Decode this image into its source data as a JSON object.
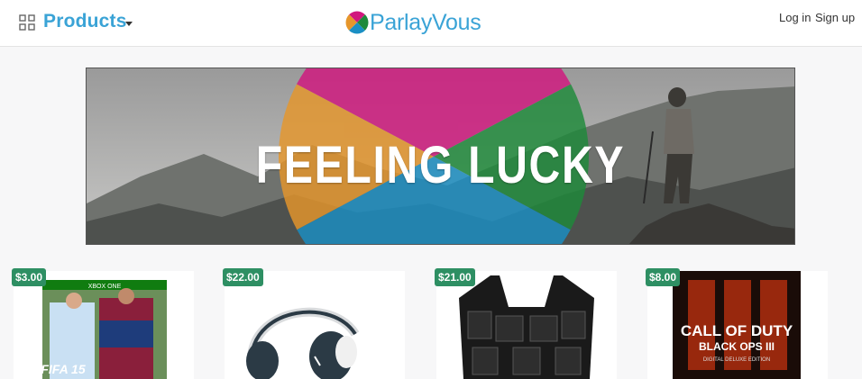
{
  "header": {
    "nav_label": "Products",
    "brand": "ParlayVous",
    "login": "Log in",
    "signup": "Sign up"
  },
  "banner": {
    "text": "FEELING LUCKY"
  },
  "products": [
    {
      "price": "$3.00",
      "image": "fifa-15-xbox-one-cover",
      "cover_top": "XBOX ONE",
      "cover_title": "FIFA 15"
    },
    {
      "price": "$22.00",
      "image": "wireless-headphones"
    },
    {
      "price": "$21.00",
      "image": "haptic-vest"
    },
    {
      "price": "$8.00",
      "image": "call-of-duty-black-ops-3-cover",
      "cover_title": "CALL OF DUTY",
      "cover_subtitle": "BLACK OPS III",
      "cover_edition": "DIGITAL DELUXE EDITION"
    }
  ],
  "colors": {
    "brand_blue": "#3aa3d6",
    "price_badge": "#2e8f63",
    "logo_orange": "#e6962b",
    "logo_magenta": "#d1177e",
    "logo_green": "#1e8a3a",
    "logo_blue": "#1a8fc4"
  }
}
